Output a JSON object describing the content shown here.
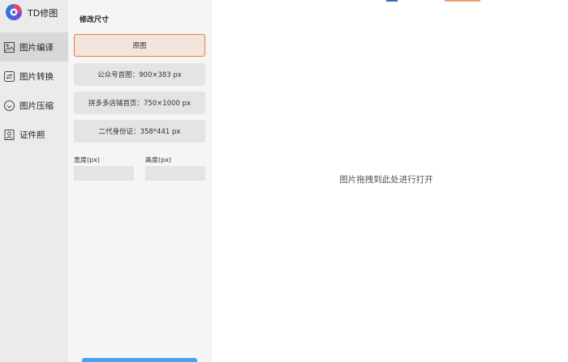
{
  "app": {
    "name": "TD修图"
  },
  "nav": {
    "items": [
      {
        "label": "图片编译",
        "icon": "image-icon",
        "active": true
      },
      {
        "label": "图片转换",
        "icon": "convert-icon",
        "active": false
      },
      {
        "label": "图片压缩",
        "icon": "compress-icon",
        "active": false
      },
      {
        "label": "证件照",
        "icon": "id-photo-icon",
        "active": false
      }
    ]
  },
  "panel": {
    "title": "修改尺寸",
    "presets": [
      {
        "label": "原图",
        "selected": true
      },
      {
        "label": "公众号首图：900×383 px",
        "selected": false
      },
      {
        "label": "拼多多店铺首页：750×1000 px",
        "selected": false
      },
      {
        "label": "二代身份证：358*441 px",
        "selected": false
      }
    ],
    "width_label": "宽度(px)",
    "height_label": "高度(px)",
    "width_value": "",
    "height_value": ""
  },
  "drop": {
    "hint": "图片拖拽到此处进行打开"
  },
  "colors": {
    "accent": "#ee7b3a",
    "primary": "#4aa3f0"
  }
}
